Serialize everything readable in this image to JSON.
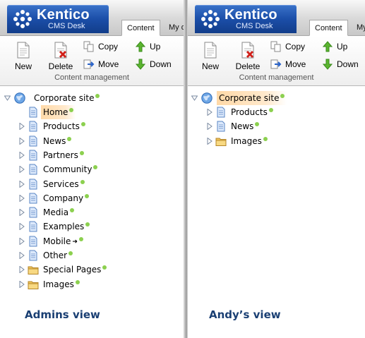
{
  "brand": {
    "name": "Kentico",
    "product": "CMS Desk"
  },
  "tabs": {
    "content": "Content",
    "my_desk": "My d"
  },
  "toolbar": {
    "new_label": "New",
    "delete_label": "Delete",
    "copy_label": "Copy",
    "move_label": "Move",
    "up_label": "Up",
    "down_label": "Down",
    "group_label": "Content management"
  },
  "colors": {
    "selected_highlight": "#ffd9a8",
    "published_dot": "#8cd04f",
    "caption": "#1a3f73",
    "brand_blue": "#1b4ea8"
  },
  "left": {
    "root": "Corporate site",
    "items": [
      "Home",
      "Products",
      "News",
      "Partners",
      "Community",
      "Services",
      "Company",
      "Media",
      "Examples",
      "Mobile",
      "Other",
      "Special Pages",
      "Images"
    ],
    "caption": "Admins view"
  },
  "right": {
    "root": "Corporate site",
    "items": [
      "Products",
      "News",
      "Images"
    ],
    "caption": "Andy’s view"
  }
}
